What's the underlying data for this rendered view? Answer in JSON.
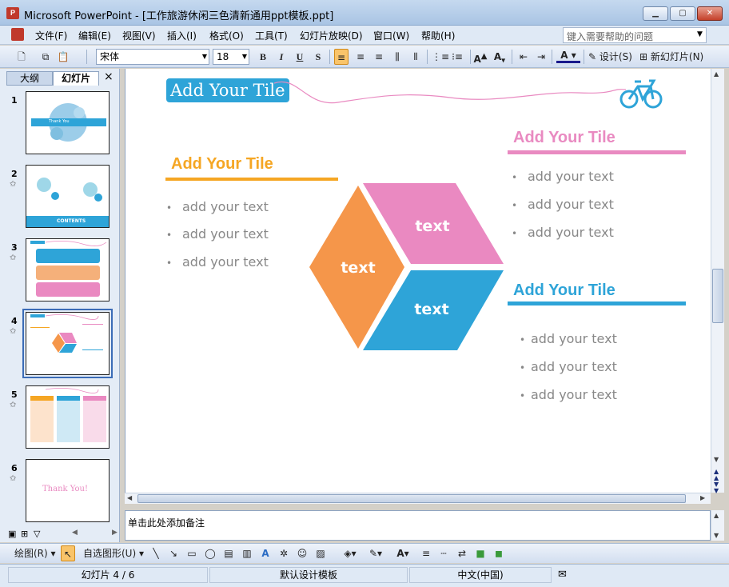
{
  "window": {
    "title": "Microsoft PowerPoint - [工作旅游休闲三色清新通用ppt模板.ppt]",
    "app_icon": "P"
  },
  "menu": [
    "文件(F)",
    "编辑(E)",
    "视图(V)",
    "插入(I)",
    "格式(O)",
    "工具(T)",
    "幻灯片放映(D)",
    "窗口(W)",
    "帮助(H)"
  ],
  "help": {
    "placeholder": "键入需要帮助的问题"
  },
  "toolbar": {
    "font": "宋体",
    "size": "18",
    "bold": "B",
    "italic": "I",
    "underline": "U",
    "shadow": "S",
    "design": "设计(S)",
    "new_slide": "新幻灯片(N)"
  },
  "panel": {
    "tab_outline": "大纲",
    "tab_slides": "幻灯片",
    "close": "×"
  },
  "thumbs": [
    {
      "num": "1",
      "caption": "Thank You"
    },
    {
      "num": "2",
      "caption": "CONTENTS"
    },
    {
      "num": "3"
    },
    {
      "num": "4"
    },
    {
      "num": "5"
    },
    {
      "num": "6",
      "caption": "Thank You!"
    }
  ],
  "slide": {
    "top_title": "Add Your Tile",
    "left": {
      "title": "Add Your Tile",
      "items": [
        "add your text",
        "add your text",
        "add your text"
      ],
      "color": "#f5a623"
    },
    "right_top": {
      "title": "Add Your Tile",
      "items": [
        "add your text",
        "add your text",
        "add your text"
      ],
      "color": "#e98ac1"
    },
    "right_bottom": {
      "title": "Add Your Tile",
      "items": [
        "add your text",
        "add your text",
        "add your text"
      ],
      "color": "#2ea4d8"
    },
    "cube": {
      "left": "text",
      "top": "text",
      "bottom": "text"
    },
    "colors": {
      "orange": "#f5964a",
      "pink": "#ea89c1",
      "blue": "#2ea4d8"
    }
  },
  "notes": {
    "placeholder": "单击此处添加备注"
  },
  "drawbar": {
    "draw": "绘图(R)",
    "autoshape": "自选图形(U)"
  },
  "status": {
    "slide": "幻灯片 4 / 6",
    "template": "默认设计模板",
    "language": "中文(中国)"
  }
}
